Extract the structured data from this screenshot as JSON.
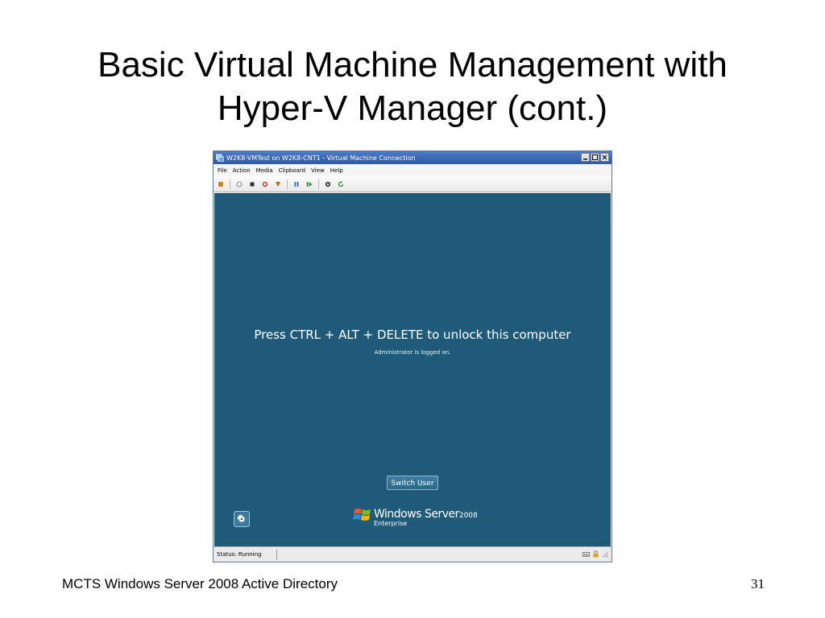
{
  "slide": {
    "title_line1": "Basic Virtual Machine Management with",
    "title_line2": "Hyper-V Manager (cont.)",
    "footer": "MCTS Windows Server 2008 Active Directory",
    "page_number": "31"
  },
  "window": {
    "title": "W2K8-VMTest on W2K8-CNT1 - Virtual Machine Connection",
    "menu": [
      "File",
      "Action",
      "Media",
      "Clipboard",
      "View",
      "Help"
    ],
    "toolbar_icons": [
      "ctrl-alt-del-icon",
      "start-icon",
      "turn-off-icon",
      "shutdown-icon",
      "save-state-icon",
      "pause-icon",
      "resume-icon",
      "snapshot-icon",
      "revert-icon"
    ]
  },
  "screen": {
    "unlock_message": "Press CTRL + ALT + DELETE to unlock this computer",
    "logged_on": "Administrator is logged on.",
    "switch_user": "Switch User",
    "brand_name": "Windows Server",
    "brand_year": "2008",
    "brand_edition": "Enterprise",
    "background_color": "#1f5b79"
  },
  "status": {
    "text": "Status: Running"
  }
}
